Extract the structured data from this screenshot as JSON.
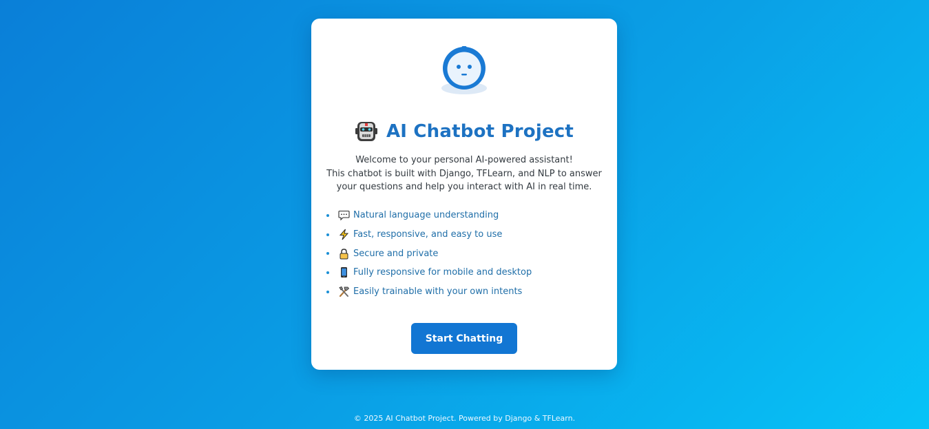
{
  "app": {
    "title": "AI Chatbot Project",
    "logo_icon": "robot-face-icon",
    "title_icon": "robot-emoji-icon"
  },
  "intro": {
    "lines": [
      "Welcome to your personal AI-powered assistant!",
      "This chatbot is built with Django, TFLearn, and NLP to answer",
      "your questions and help you interact with AI in real time."
    ]
  },
  "features": [
    {
      "icon": "speech-bubble-icon",
      "label": "Natural language understanding"
    },
    {
      "icon": "lightning-icon",
      "label": "Fast, responsive, and easy to use"
    },
    {
      "icon": "lock-icon",
      "label": "Secure and private"
    },
    {
      "icon": "mobile-phone-icon",
      "label": "Fully responsive for mobile and desktop"
    },
    {
      "icon": "tools-icon",
      "label": "Easily trainable with your own intents"
    }
  ],
  "actions": {
    "start_label": "Start Chatting"
  },
  "footer": {
    "text": "© 2025 AI Chatbot Project. Powered by Django & TFLearn."
  },
  "colors": {
    "accent": "#1276d3",
    "title": "#1d72c2",
    "feature_text": "#1f6ea8",
    "background_start": "#0a7fd8",
    "background_end": "#07c3f7"
  }
}
